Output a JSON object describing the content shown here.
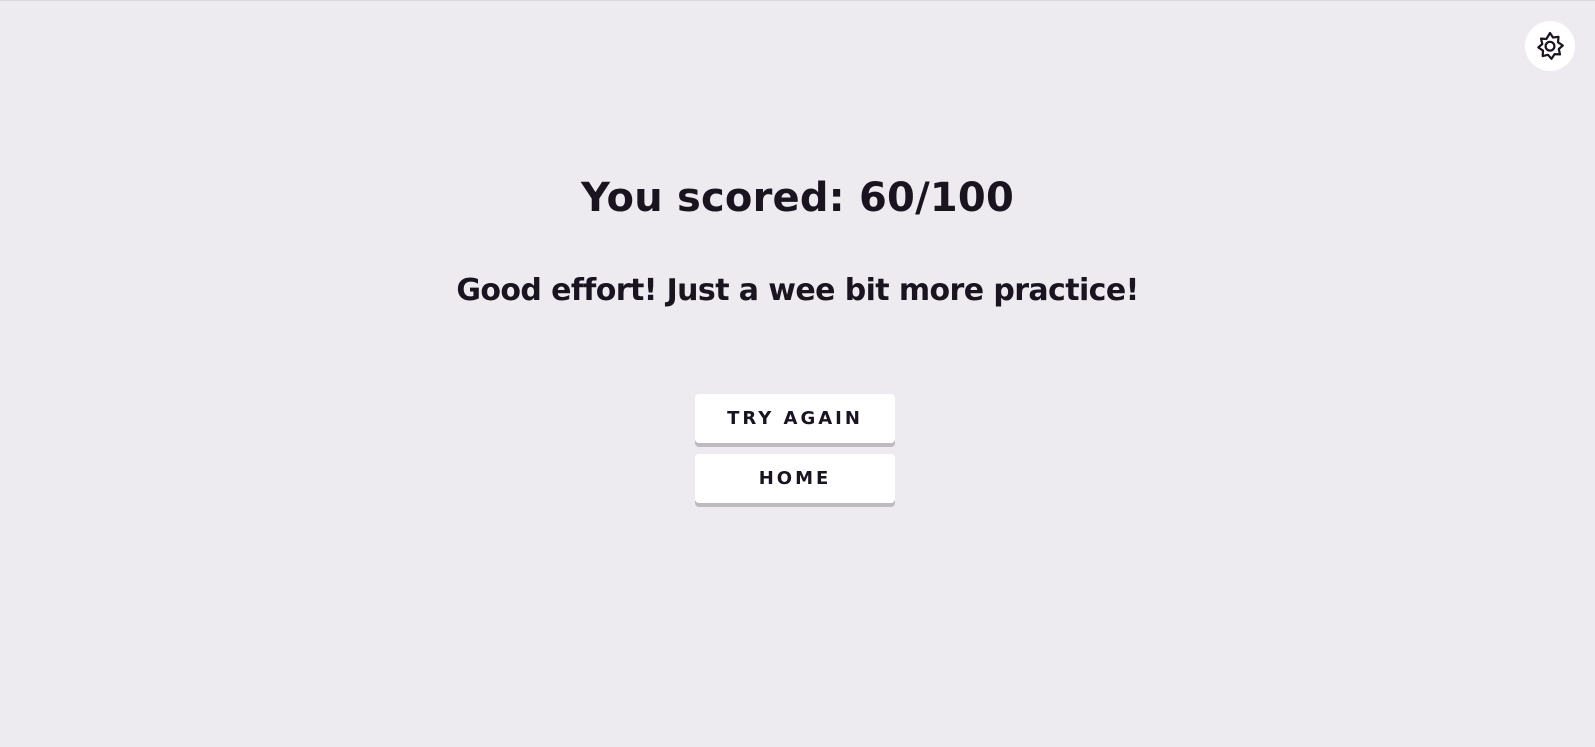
{
  "settings": {
    "icon": "gear-icon"
  },
  "result": {
    "score_text": "You scored: 60/100",
    "message": "Good effort! Just a wee bit more practice!"
  },
  "actions": {
    "try_again_label": "TRY AGAIN",
    "home_label": "HOME"
  },
  "colors": {
    "background": "#edebf0",
    "text": "#1a1420",
    "button": "#ffffff",
    "button_shadow": "#bdbbc1"
  }
}
